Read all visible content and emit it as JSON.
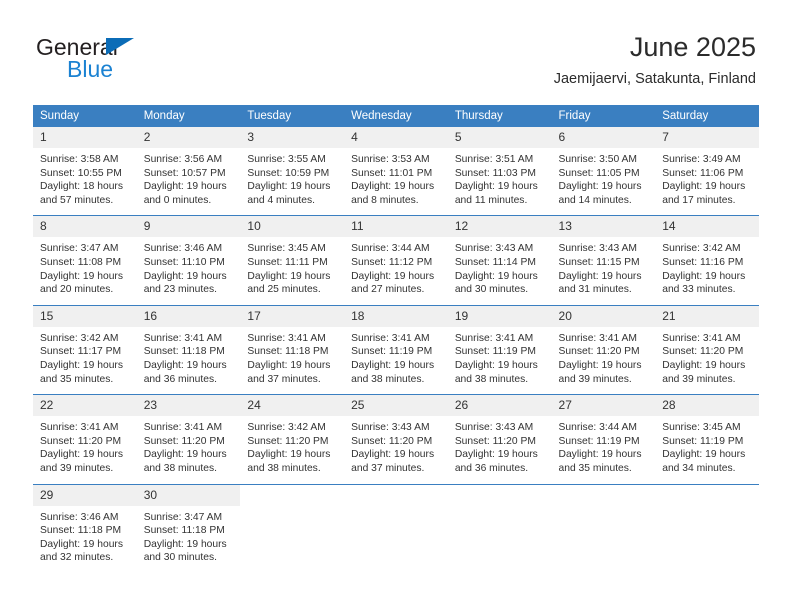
{
  "brand": {
    "name_part1": "General",
    "name_part2": "Blue",
    "flag_icon": "triangle-flag-icon"
  },
  "header": {
    "title": "June 2025",
    "subtitle": "Jaemijaervi, Satakunta, Finland"
  },
  "colors": {
    "header_blue": "#3a7fc1",
    "brand_blue": "#1b82d2",
    "daynum_band": "#f0f0f0",
    "text": "#333333"
  },
  "weekday_headers": [
    "Sunday",
    "Monday",
    "Tuesday",
    "Wednesday",
    "Thursday",
    "Friday",
    "Saturday"
  ],
  "weeks": [
    [
      {
        "day": "1",
        "sunrise": "Sunrise: 3:58 AM",
        "sunset": "Sunset: 10:55 PM",
        "daylight_line1": "Daylight: 18 hours",
        "daylight_line2": "and 57 minutes."
      },
      {
        "day": "2",
        "sunrise": "Sunrise: 3:56 AM",
        "sunset": "Sunset: 10:57 PM",
        "daylight_line1": "Daylight: 19 hours",
        "daylight_line2": "and 0 minutes."
      },
      {
        "day": "3",
        "sunrise": "Sunrise: 3:55 AM",
        "sunset": "Sunset: 10:59 PM",
        "daylight_line1": "Daylight: 19 hours",
        "daylight_line2": "and 4 minutes."
      },
      {
        "day": "4",
        "sunrise": "Sunrise: 3:53 AM",
        "sunset": "Sunset: 11:01 PM",
        "daylight_line1": "Daylight: 19 hours",
        "daylight_line2": "and 8 minutes."
      },
      {
        "day": "5",
        "sunrise": "Sunrise: 3:51 AM",
        "sunset": "Sunset: 11:03 PM",
        "daylight_line1": "Daylight: 19 hours",
        "daylight_line2": "and 11 minutes."
      },
      {
        "day": "6",
        "sunrise": "Sunrise: 3:50 AM",
        "sunset": "Sunset: 11:05 PM",
        "daylight_line1": "Daylight: 19 hours",
        "daylight_line2": "and 14 minutes."
      },
      {
        "day": "7",
        "sunrise": "Sunrise: 3:49 AM",
        "sunset": "Sunset: 11:06 PM",
        "daylight_line1": "Daylight: 19 hours",
        "daylight_line2": "and 17 minutes."
      }
    ],
    [
      {
        "day": "8",
        "sunrise": "Sunrise: 3:47 AM",
        "sunset": "Sunset: 11:08 PM",
        "daylight_line1": "Daylight: 19 hours",
        "daylight_line2": "and 20 minutes."
      },
      {
        "day": "9",
        "sunrise": "Sunrise: 3:46 AM",
        "sunset": "Sunset: 11:10 PM",
        "daylight_line1": "Daylight: 19 hours",
        "daylight_line2": "and 23 minutes."
      },
      {
        "day": "10",
        "sunrise": "Sunrise: 3:45 AM",
        "sunset": "Sunset: 11:11 PM",
        "daylight_line1": "Daylight: 19 hours",
        "daylight_line2": "and 25 minutes."
      },
      {
        "day": "11",
        "sunrise": "Sunrise: 3:44 AM",
        "sunset": "Sunset: 11:12 PM",
        "daylight_line1": "Daylight: 19 hours",
        "daylight_line2": "and 27 minutes."
      },
      {
        "day": "12",
        "sunrise": "Sunrise: 3:43 AM",
        "sunset": "Sunset: 11:14 PM",
        "daylight_line1": "Daylight: 19 hours",
        "daylight_line2": "and 30 minutes."
      },
      {
        "day": "13",
        "sunrise": "Sunrise: 3:43 AM",
        "sunset": "Sunset: 11:15 PM",
        "daylight_line1": "Daylight: 19 hours",
        "daylight_line2": "and 31 minutes."
      },
      {
        "day": "14",
        "sunrise": "Sunrise: 3:42 AM",
        "sunset": "Sunset: 11:16 PM",
        "daylight_line1": "Daylight: 19 hours",
        "daylight_line2": "and 33 minutes."
      }
    ],
    [
      {
        "day": "15",
        "sunrise": "Sunrise: 3:42 AM",
        "sunset": "Sunset: 11:17 PM",
        "daylight_line1": "Daylight: 19 hours",
        "daylight_line2": "and 35 minutes."
      },
      {
        "day": "16",
        "sunrise": "Sunrise: 3:41 AM",
        "sunset": "Sunset: 11:18 PM",
        "daylight_line1": "Daylight: 19 hours",
        "daylight_line2": "and 36 minutes."
      },
      {
        "day": "17",
        "sunrise": "Sunrise: 3:41 AM",
        "sunset": "Sunset: 11:18 PM",
        "daylight_line1": "Daylight: 19 hours",
        "daylight_line2": "and 37 minutes."
      },
      {
        "day": "18",
        "sunrise": "Sunrise: 3:41 AM",
        "sunset": "Sunset: 11:19 PM",
        "daylight_line1": "Daylight: 19 hours",
        "daylight_line2": "and 38 minutes."
      },
      {
        "day": "19",
        "sunrise": "Sunrise: 3:41 AM",
        "sunset": "Sunset: 11:19 PM",
        "daylight_line1": "Daylight: 19 hours",
        "daylight_line2": "and 38 minutes."
      },
      {
        "day": "20",
        "sunrise": "Sunrise: 3:41 AM",
        "sunset": "Sunset: 11:20 PM",
        "daylight_line1": "Daylight: 19 hours",
        "daylight_line2": "and 39 minutes."
      },
      {
        "day": "21",
        "sunrise": "Sunrise: 3:41 AM",
        "sunset": "Sunset: 11:20 PM",
        "daylight_line1": "Daylight: 19 hours",
        "daylight_line2": "and 39 minutes."
      }
    ],
    [
      {
        "day": "22",
        "sunrise": "Sunrise: 3:41 AM",
        "sunset": "Sunset: 11:20 PM",
        "daylight_line1": "Daylight: 19 hours",
        "daylight_line2": "and 39 minutes."
      },
      {
        "day": "23",
        "sunrise": "Sunrise: 3:41 AM",
        "sunset": "Sunset: 11:20 PM",
        "daylight_line1": "Daylight: 19 hours",
        "daylight_line2": "and 38 minutes."
      },
      {
        "day": "24",
        "sunrise": "Sunrise: 3:42 AM",
        "sunset": "Sunset: 11:20 PM",
        "daylight_line1": "Daylight: 19 hours",
        "daylight_line2": "and 38 minutes."
      },
      {
        "day": "25",
        "sunrise": "Sunrise: 3:43 AM",
        "sunset": "Sunset: 11:20 PM",
        "daylight_line1": "Daylight: 19 hours",
        "daylight_line2": "and 37 minutes."
      },
      {
        "day": "26",
        "sunrise": "Sunrise: 3:43 AM",
        "sunset": "Sunset: 11:20 PM",
        "daylight_line1": "Daylight: 19 hours",
        "daylight_line2": "and 36 minutes."
      },
      {
        "day": "27",
        "sunrise": "Sunrise: 3:44 AM",
        "sunset": "Sunset: 11:19 PM",
        "daylight_line1": "Daylight: 19 hours",
        "daylight_line2": "and 35 minutes."
      },
      {
        "day": "28",
        "sunrise": "Sunrise: 3:45 AM",
        "sunset": "Sunset: 11:19 PM",
        "daylight_line1": "Daylight: 19 hours",
        "daylight_line2": "and 34 minutes."
      }
    ],
    [
      {
        "day": "29",
        "sunrise": "Sunrise: 3:46 AM",
        "sunset": "Sunset: 11:18 PM",
        "daylight_line1": "Daylight: 19 hours",
        "daylight_line2": "and 32 minutes."
      },
      {
        "day": "30",
        "sunrise": "Sunrise: 3:47 AM",
        "sunset": "Sunset: 11:18 PM",
        "daylight_line1": "Daylight: 19 hours",
        "daylight_line2": "and 30 minutes."
      },
      null,
      null,
      null,
      null,
      null
    ]
  ]
}
